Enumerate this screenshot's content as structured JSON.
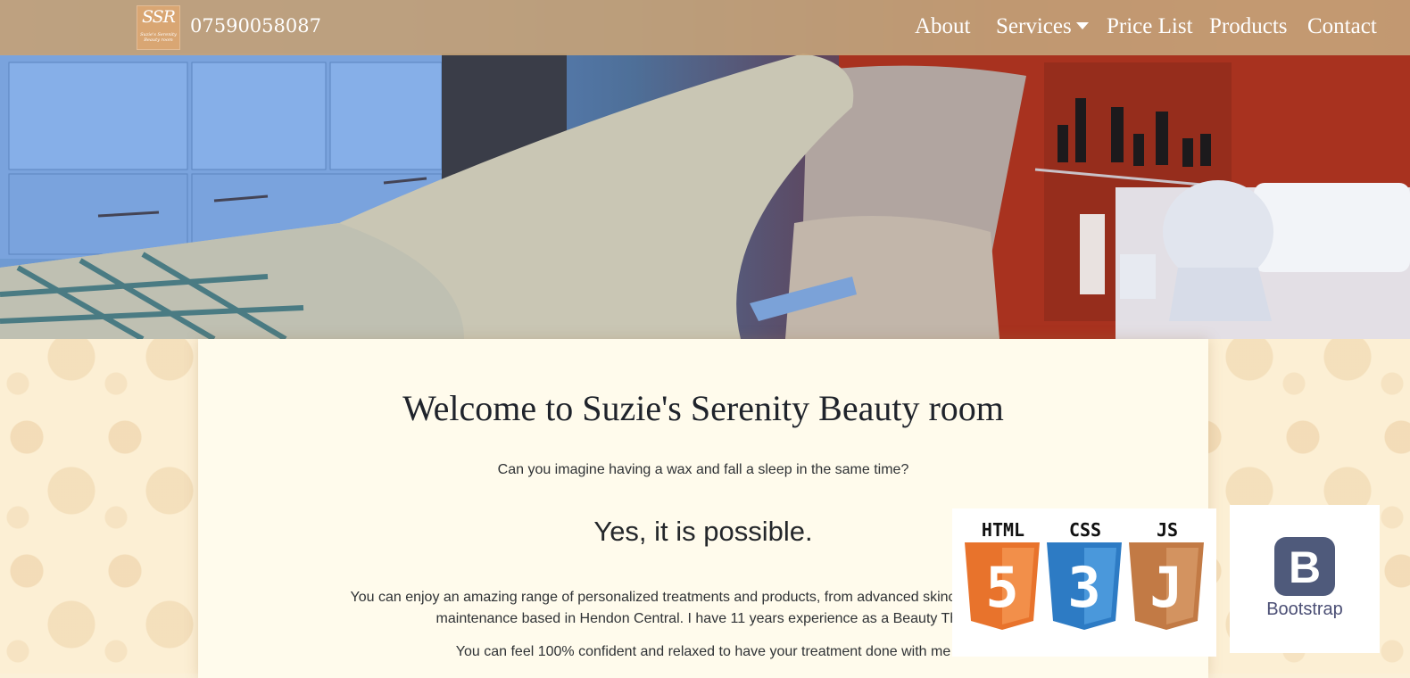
{
  "navbar": {
    "logo": {
      "initials": "SSR",
      "tagline": "Suzie's Serenity Beauty room"
    },
    "phone": "07590058087",
    "items": [
      {
        "label": "About"
      },
      {
        "label": "Services",
        "has_dropdown": true
      },
      {
        "label": "Price List"
      },
      {
        "label": "Products"
      },
      {
        "label": "Contact"
      }
    ]
  },
  "hero": {
    "icon": "treatment-room-photo"
  },
  "content": {
    "title": "Welcome to Suzie's Serenity Beauty room",
    "subtitle": "Can you imagine having a wax and fall a sleep in the same time?",
    "headline": "Yes, it is possible.",
    "paragraph_line1": "You can enjoy an amazing range of personalized treatments and products, from advanced skincare to body wax",
    "paragraph_line2": "maintenance based in Hendon Central. I have 11 years experience as a Beauty Ther",
    "paragraph2": "You can feel 100% confident and relaxed to have your treatment done with me"
  },
  "badges": {
    "html": {
      "label": "HTML",
      "number": "5",
      "color": "#e8732c"
    },
    "css": {
      "label": "CSS",
      "number": "3",
      "color": "#2d7bc4"
    },
    "js": {
      "label": "JS",
      "number": "J",
      "color": "#c27a45"
    },
    "bootstrap": {
      "label": "Bootstrap",
      "letter": "B",
      "color": "#4f5a7b"
    }
  }
}
